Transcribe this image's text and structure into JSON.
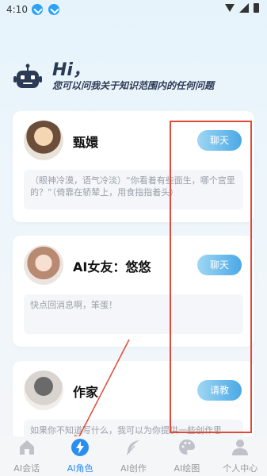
{
  "status_bar": {
    "time": "4:10"
  },
  "header": {
    "greeting": "Hi，",
    "subtitle": "您可以问我关于知识范围内的任何问题"
  },
  "cards": [
    {
      "name": "甄嬛",
      "button": "聊天",
      "description": "（眼神冷漠，语气冷淡）“你看着有些面生，哪个宫里的？”（倚靠在轿辇上，用食指指着头）"
    },
    {
      "name": "AI女友：悠悠",
      "button": "聊天",
      "description": "快点回消息啊，笨蛋！"
    },
    {
      "name": "作家",
      "button": "请教",
      "description": "如果你不知道写什么，我可以为你提供一些创作思"
    }
  ],
  "tabs": [
    {
      "label": "AI会话",
      "icon": "home-icon",
      "active": false
    },
    {
      "label": "AI角色",
      "icon": "lightning-icon",
      "active": true
    },
    {
      "label": "AI创作",
      "icon": "feather-icon",
      "active": false
    },
    {
      "label": "AI绘图",
      "icon": "palette-icon",
      "active": false
    },
    {
      "label": "个人中心",
      "icon": "person-icon",
      "active": false
    }
  ],
  "colors": {
    "accent": "#2a8ef0",
    "button_gradient_start": "#9fd7f3",
    "button_gradient_end": "#4aa8e6",
    "highlight": "#e04a3b",
    "title": "#2b3a55"
  }
}
